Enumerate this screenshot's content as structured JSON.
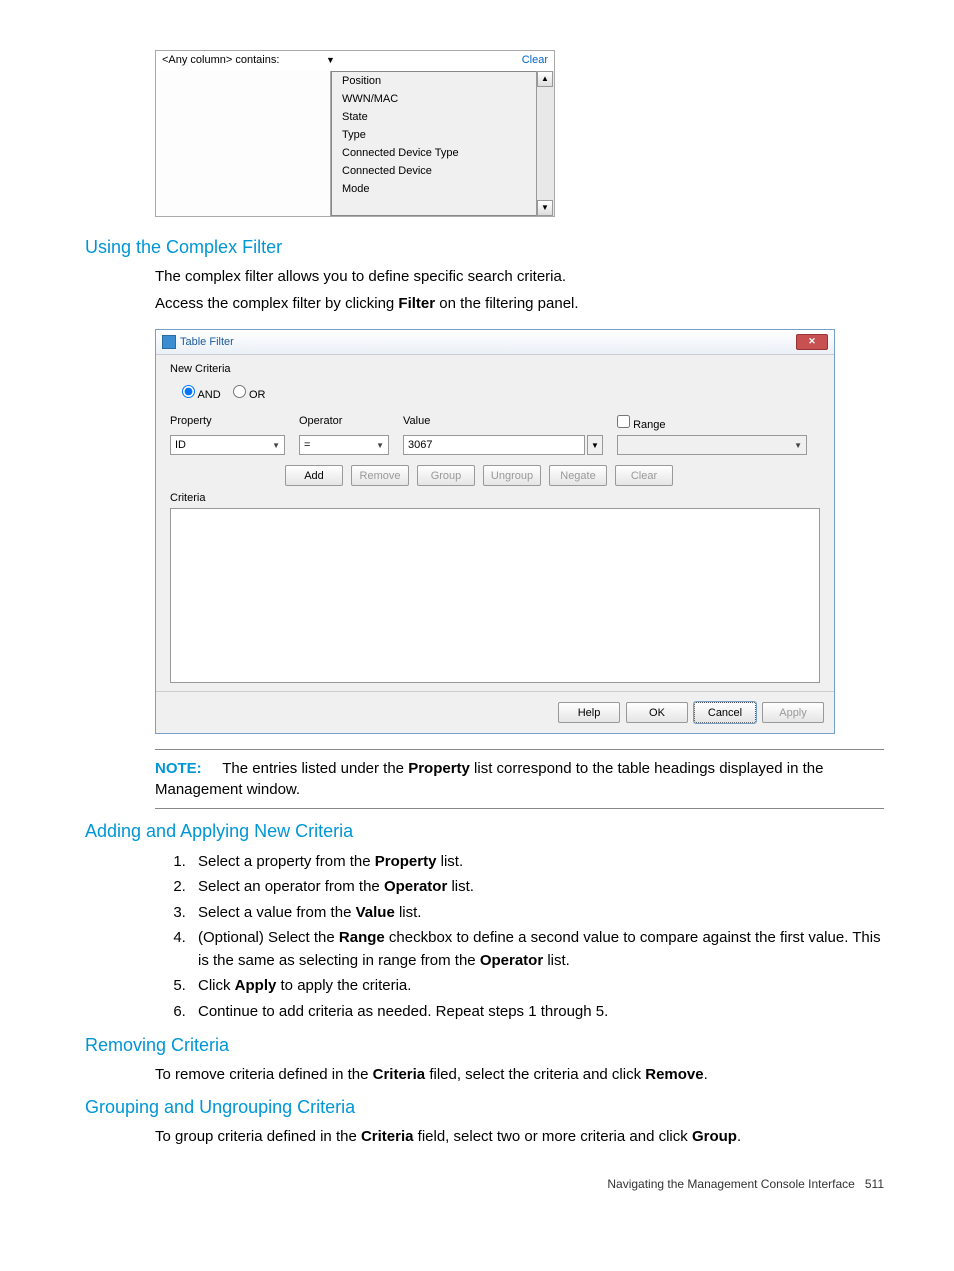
{
  "screenshot1": {
    "filter_label": "<Any column> contains:",
    "clear": "Clear",
    "options": [
      "Position",
      "WWN/MAC",
      "State",
      "Type",
      "Connected Device Type",
      "Connected Device",
      "Mode"
    ]
  },
  "section1": {
    "heading": "Using the Complex Filter",
    "para1": "The complex filter allows you to define specific search criteria.",
    "para2a": "Access the complex filter by clicking ",
    "para2b": "Filter",
    "para2c": " on the filtering panel."
  },
  "screenshot2": {
    "title": "Table Filter",
    "new_criteria": "New Criteria",
    "and": "AND",
    "or": "OR",
    "labels": {
      "property": "Property",
      "operator": "Operator",
      "value": "Value",
      "range": "Range"
    },
    "property_val": "ID",
    "operator_val": "=",
    "value_val": "3067",
    "btns": {
      "add": "Add",
      "remove": "Remove",
      "group": "Group",
      "ungroup": "Ungroup",
      "negate": "Negate",
      "clear": "Clear"
    },
    "criteria_label": "Criteria",
    "footer": {
      "help": "Help",
      "ok": "OK",
      "cancel": "Cancel",
      "apply": "Apply"
    }
  },
  "note": {
    "label": "NOTE:",
    "text_a": "The entries listed under the ",
    "text_b": "Property",
    "text_c": " list correspond to the table headings displayed in the Management window."
  },
  "section2": {
    "heading": "Adding and Applying New Criteria",
    "s1a": "Select a property from the ",
    "s1b": "Property",
    "s1c": " list.",
    "s2a": "Select an operator from the ",
    "s2b": "Operator",
    "s2c": " list.",
    "s3a": "Select a value from the ",
    "s3b": "Value",
    "s3c": " list.",
    "s4a": "(Optional) Select the ",
    "s4b": "Range",
    "s4c": " checkbox to define a second value to compare against the first value. This is the same as selecting in range from the ",
    "s4d": "Operator",
    "s4e": " list.",
    "s5a": "Click ",
    "s5b": "Apply",
    "s5c": " to apply the criteria.",
    "s6": "Continue to add criteria as needed. Repeat steps 1 through 5."
  },
  "section3": {
    "heading": "Removing Criteria",
    "p_a": "To remove criteria defined in the ",
    "p_b": "Criteria",
    "p_c": " filed, select the criteria and click ",
    "p_d": "Remove",
    "p_e": "."
  },
  "section4": {
    "heading": "Grouping and Ungrouping Criteria",
    "p_a": "To group criteria defined in the ",
    "p_b": "Criteria",
    "p_c": " field, select two or more criteria and click ",
    "p_d": "Group",
    "p_e": "."
  },
  "footer": {
    "text": "Navigating the Management Console Interface",
    "page": "511"
  }
}
